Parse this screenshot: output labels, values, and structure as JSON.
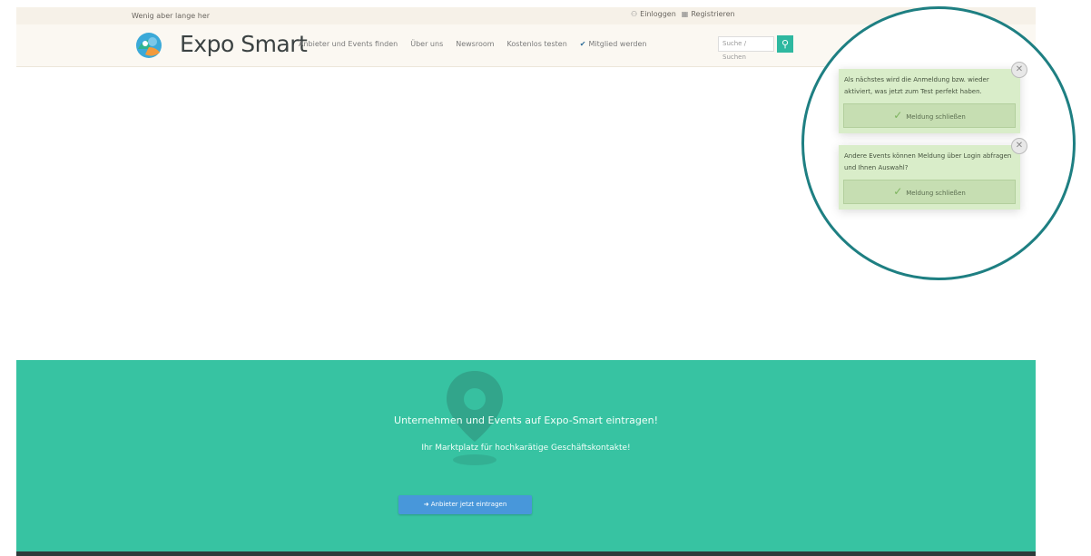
{
  "topbar": {
    "welcome": "Wenig aber lange her",
    "login": "Einloggen",
    "register": "Registrieren"
  },
  "header": {
    "brand": "Expo Smart",
    "nav": [
      "Anbieter und Events finden",
      "Über uns",
      "Newsroom",
      "Kostenlos testen"
    ],
    "member_label": "Mitglied werden",
    "search_placeholder": "Suche / Suchen"
  },
  "banner": {
    "title": "Unternehmen und Events auf Expo-Smart eintragen!",
    "subtitle": "Ihr Marktplatz für hochkarätige Geschäftskontakte!",
    "cta_label": "Anbieter jetzt eintragen"
  },
  "notifications": [
    {
      "message": "Als nächstes wird die Anmeldung bzw. wieder aktiviert, was jetzt zum Test perfekt haben.",
      "button": "Meldung schließen"
    },
    {
      "message": "Andere Events können Meldung über Login abfragen und Ihnen Auswahl?",
      "button": "Meldung schließen"
    }
  ],
  "colors": {
    "accent_green": "#37c3a2",
    "ring": "#1e7f82",
    "cta_blue": "#4897da",
    "notif_bg": "#d9edc9"
  }
}
